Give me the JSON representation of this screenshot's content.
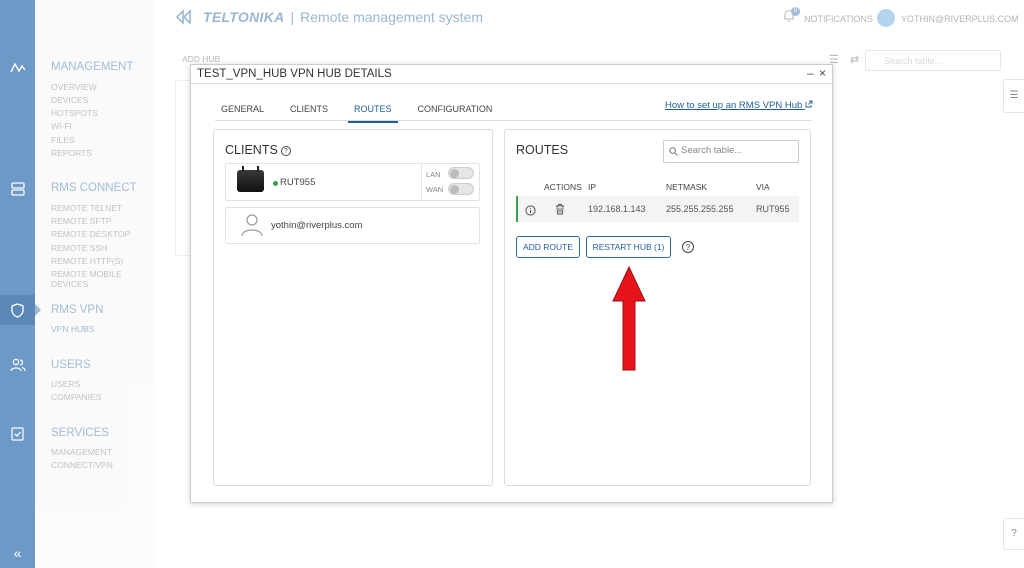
{
  "header": {
    "brand": "TELTONIKA",
    "separator": "|",
    "app_title": "Remote management system",
    "notifications_label": "NOTIFICATIONS",
    "notifications_count": "0",
    "user_email": "YOTHIN@RIVERPLUS.COM"
  },
  "sidebar": {
    "collapse_label": "«",
    "sections": [
      {
        "title": "MANAGEMENT",
        "items": [
          "OVERVIEW",
          "DEVICES",
          "HOTSPOTS",
          "WI-FI",
          "FILES",
          "REPORTS"
        ]
      },
      {
        "title": "RMS CONNECT",
        "items": [
          "REMOTE TELNET",
          "REMOTE SFTP",
          "REMOTE DESKTOP",
          "REMOTE SSH",
          "REMOTE HTTP(S)",
          "REMOTE MOBILE DEVICES"
        ]
      },
      {
        "title": "RMS VPN",
        "items": [
          "VPN HUBS"
        ]
      },
      {
        "title": "USERS",
        "items": [
          "USERS",
          "COMPANIES"
        ]
      },
      {
        "title": "SERVICES",
        "items": [
          "MANAGEMENT",
          "CONNECT/VPN"
        ]
      }
    ]
  },
  "background": {
    "add_hub_label": "ADD HUB",
    "search_placeholder": "Search table..."
  },
  "modal": {
    "title": "TEST_VPN_HUB VPN HUB DETAILS",
    "minimize": "–",
    "close": "×",
    "tabs": [
      {
        "label": "GENERAL"
      },
      {
        "label": "CLIENTS"
      },
      {
        "label": "ROUTES"
      },
      {
        "label": "CONFIGURATION"
      }
    ],
    "active_tab": "ROUTES",
    "howto_link": "How to set up an RMS VPN Hub",
    "clients": {
      "title": "CLIENTS",
      "device": {
        "name": "RUT955",
        "status_color": "#3aa34a",
        "lan_label": "LAN",
        "wan_label": "WAN"
      },
      "user": {
        "email": "yothin@riverplus.com"
      }
    },
    "routes": {
      "title": "ROUTES",
      "search_placeholder": "Search table...",
      "columns": [
        "ACTIONS",
        "IP",
        "NETMASK",
        "VIA"
      ],
      "rows": [
        {
          "ip": "192.168.1.143",
          "netmask": "255.255.255.255",
          "via": "RUT955"
        }
      ],
      "add_route_label": "ADD ROUTE",
      "restart_hub_label": "RESTART HUB (1)"
    }
  },
  "colors": {
    "rail": "#6d99c6",
    "accent": "#1f5e9a",
    "arrow": "#e8141c"
  }
}
